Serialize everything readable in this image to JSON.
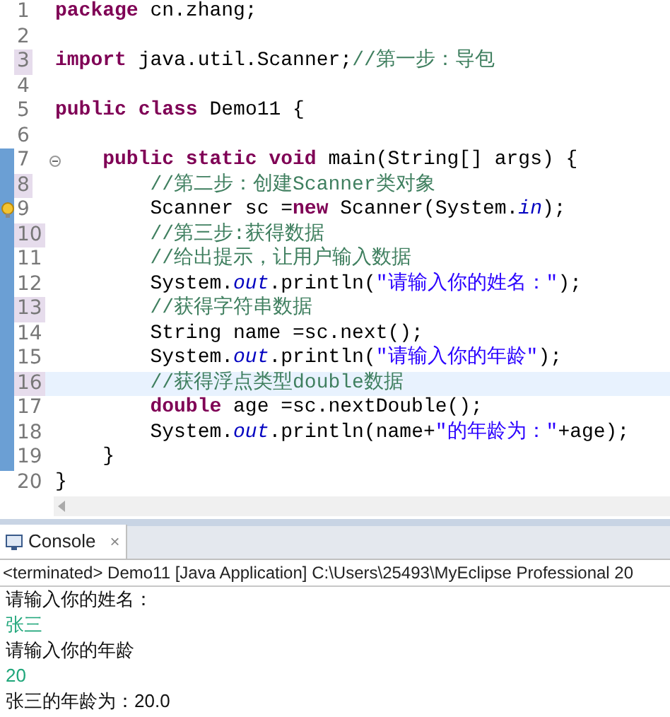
{
  "editor": {
    "lines": [
      {
        "number": "1",
        "changed": false,
        "in_range": false,
        "current": false,
        "fold_toggle": false,
        "warning": false,
        "tokens": [
          {
            "kind": "keyword",
            "text": "package"
          },
          {
            "kind": "plain",
            "text": " cn.zhang;"
          }
        ]
      },
      {
        "number": "2",
        "changed": false,
        "in_range": false,
        "current": false,
        "fold_toggle": false,
        "warning": false
      },
      {
        "number": "3",
        "changed": true,
        "in_range": false,
        "current": false,
        "fold_toggle": false,
        "warning": false,
        "tokens": [
          {
            "kind": "keyword",
            "text": "import"
          },
          {
            "kind": "plain",
            "text": " java.util.Scanner;"
          },
          {
            "kind": "comment",
            "text": "//第一步：导包"
          }
        ]
      },
      {
        "number": "4",
        "changed": false,
        "in_range": false,
        "current": false,
        "fold_toggle": false,
        "warning": false
      },
      {
        "number": "5",
        "changed": false,
        "in_range": false,
        "current": false,
        "fold_toggle": false,
        "warning": false,
        "tokens": [
          {
            "kind": "keyword",
            "text": "public"
          },
          {
            "kind": "keyword",
            "text": " class"
          },
          {
            "kind": "plain",
            "text": " Demo11 {"
          }
        ]
      },
      {
        "number": "6",
        "changed": false,
        "in_range": false,
        "current": false,
        "fold_toggle": false,
        "warning": false
      },
      {
        "number": "7",
        "changed": false,
        "in_range": true,
        "current": false,
        "fold_toggle": true,
        "warning": false,
        "tokens": [
          {
            "kind": "keyword",
            "text": "    public"
          },
          {
            "kind": "keyword",
            "text": " static"
          },
          {
            "kind": "keyword",
            "text": " void"
          },
          {
            "kind": "plain",
            "text": " main(String[] args) {"
          }
        ]
      },
      {
        "number": "8",
        "changed": true,
        "in_range": true,
        "current": false,
        "fold_toggle": false,
        "warning": false,
        "tokens": [
          {
            "kind": "comment",
            "text": "        //第二步：创建Scanner类对象"
          }
        ]
      },
      {
        "number": "9",
        "changed": false,
        "in_range": true,
        "current": false,
        "fold_toggle": false,
        "warning": true,
        "tokens": [
          {
            "kind": "plain",
            "text": "        Scanner sc ="
          },
          {
            "kind": "keyword",
            "text": "new"
          },
          {
            "kind": "plain",
            "text": " Scanner(System."
          },
          {
            "kind": "field",
            "text": "in"
          },
          {
            "kind": "plain",
            "text": ");"
          }
        ]
      },
      {
        "number": "10",
        "changed": true,
        "in_range": true,
        "current": false,
        "fold_toggle": false,
        "warning": false,
        "tokens": [
          {
            "kind": "comment",
            "text": "        //第三步:获得数据"
          }
        ]
      },
      {
        "number": "11",
        "changed": false,
        "in_range": true,
        "current": false,
        "fold_toggle": false,
        "warning": false,
        "tokens": [
          {
            "kind": "comment",
            "text": "        //给出提示，让用户输入数据"
          }
        ]
      },
      {
        "number": "12",
        "changed": false,
        "in_range": true,
        "current": false,
        "fold_toggle": false,
        "warning": false,
        "tokens": [
          {
            "kind": "plain",
            "text": "        System."
          },
          {
            "kind": "field",
            "text": "out"
          },
          {
            "kind": "plain",
            "text": ".println("
          },
          {
            "kind": "string",
            "text": "\"请输入你的姓名：\""
          },
          {
            "kind": "plain",
            "text": ");"
          }
        ]
      },
      {
        "number": "13",
        "changed": true,
        "in_range": true,
        "current": false,
        "fold_toggle": false,
        "warning": false,
        "tokens": [
          {
            "kind": "comment",
            "text": "        //获得字符串数据"
          }
        ]
      },
      {
        "number": "14",
        "changed": false,
        "in_range": true,
        "current": false,
        "fold_toggle": false,
        "warning": false,
        "tokens": [
          {
            "kind": "plain",
            "text": "        String name =sc.next();"
          }
        ]
      },
      {
        "number": "15",
        "changed": false,
        "in_range": true,
        "current": false,
        "fold_toggle": false,
        "warning": false,
        "tokens": [
          {
            "kind": "plain",
            "text": "        System."
          },
          {
            "kind": "field",
            "text": "out"
          },
          {
            "kind": "plain",
            "text": ".println("
          },
          {
            "kind": "string",
            "text": "\"请输入你的年龄\""
          },
          {
            "kind": "plain",
            "text": ");"
          }
        ]
      },
      {
        "number": "16",
        "changed": true,
        "in_range": true,
        "current": true,
        "fold_toggle": false,
        "warning": false,
        "tokens": [
          {
            "kind": "comment",
            "text": "        //获得浮点类型double数据"
          }
        ]
      },
      {
        "number": "17",
        "changed": false,
        "in_range": true,
        "current": false,
        "fold_toggle": false,
        "warning": false,
        "tokens": [
          {
            "kind": "keyword",
            "text": "        double"
          },
          {
            "kind": "plain",
            "text": " age =sc.nextDouble();"
          }
        ]
      },
      {
        "number": "18",
        "changed": false,
        "in_range": true,
        "current": false,
        "fold_toggle": false,
        "warning": false,
        "tokens": [
          {
            "kind": "plain",
            "text": "        System."
          },
          {
            "kind": "field",
            "text": "out"
          },
          {
            "kind": "plain",
            "text": ".println(name+"
          },
          {
            "kind": "string",
            "text": "\"的年龄为：\""
          },
          {
            "kind": "plain",
            "text": "+age);"
          }
        ]
      },
      {
        "number": "19",
        "changed": false,
        "in_range": true,
        "current": false,
        "fold_toggle": false,
        "warning": false,
        "tokens": [
          {
            "kind": "plain",
            "text": "    }"
          }
        ]
      },
      {
        "number": "20",
        "changed": false,
        "in_range": false,
        "current": false,
        "fold_toggle": false,
        "warning": false,
        "tokens": [
          {
            "kind": "plain",
            "text": "}"
          }
        ]
      }
    ]
  },
  "console": {
    "tab": {
      "label": "Console",
      "close": "×"
    },
    "status": "<terminated> Demo11 [Java Application] C:\\Users\\25493\\MyEclipse Professional 20",
    "output": [
      {
        "kind": "output",
        "text": "请输入你的姓名："
      },
      {
        "kind": "input",
        "text": "张三"
      },
      {
        "kind": "output",
        "text": "请输入你的年龄"
      },
      {
        "kind": "input",
        "text": "20"
      },
      {
        "kind": "output",
        "text": "张三的年龄为：20.0"
      }
    ]
  }
}
